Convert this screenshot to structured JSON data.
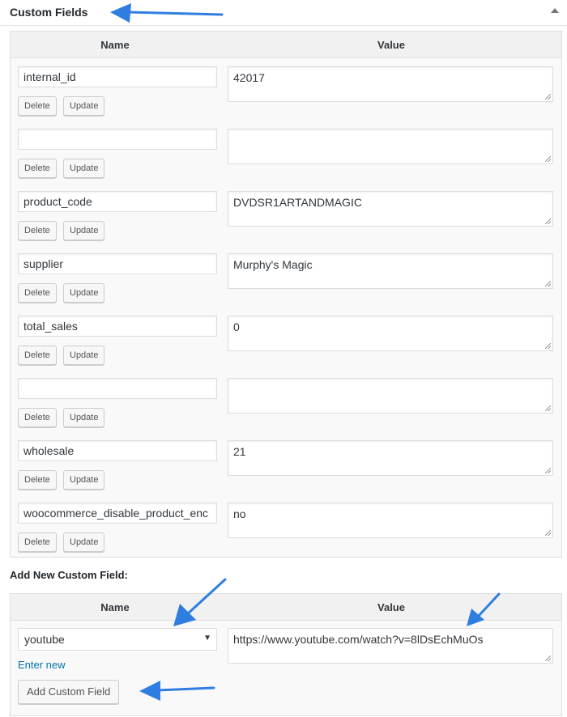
{
  "panel": {
    "title": "Custom Fields"
  },
  "columns": {
    "name": "Name",
    "value": "Value"
  },
  "buttons": {
    "delete": "Delete",
    "update": "Update"
  },
  "fields": [
    {
      "key": "internal_id",
      "value": "42017"
    },
    {
      "key": "",
      "value": ""
    },
    {
      "key": "product_code",
      "value": "DVDSR1ARTANDMAGIC"
    },
    {
      "key": "supplier",
      "value": "Murphy's Magic"
    },
    {
      "key": "total_sales",
      "value": "0"
    },
    {
      "key": "",
      "value": ""
    },
    {
      "key": "wholesale",
      "value": "21"
    },
    {
      "key": "woocommerce_disable_product_enc",
      "value": "no"
    }
  ],
  "add_new": {
    "heading": "Add New Custom Field:",
    "selected_key": "youtube",
    "enter_new": "Enter new",
    "value": "https://www.youtube.com/watch?v=8lDsEchMuOs",
    "button": "Add Custom Field"
  },
  "colors": {
    "arrow": "#2f7de1",
    "link": "#0073aa"
  }
}
